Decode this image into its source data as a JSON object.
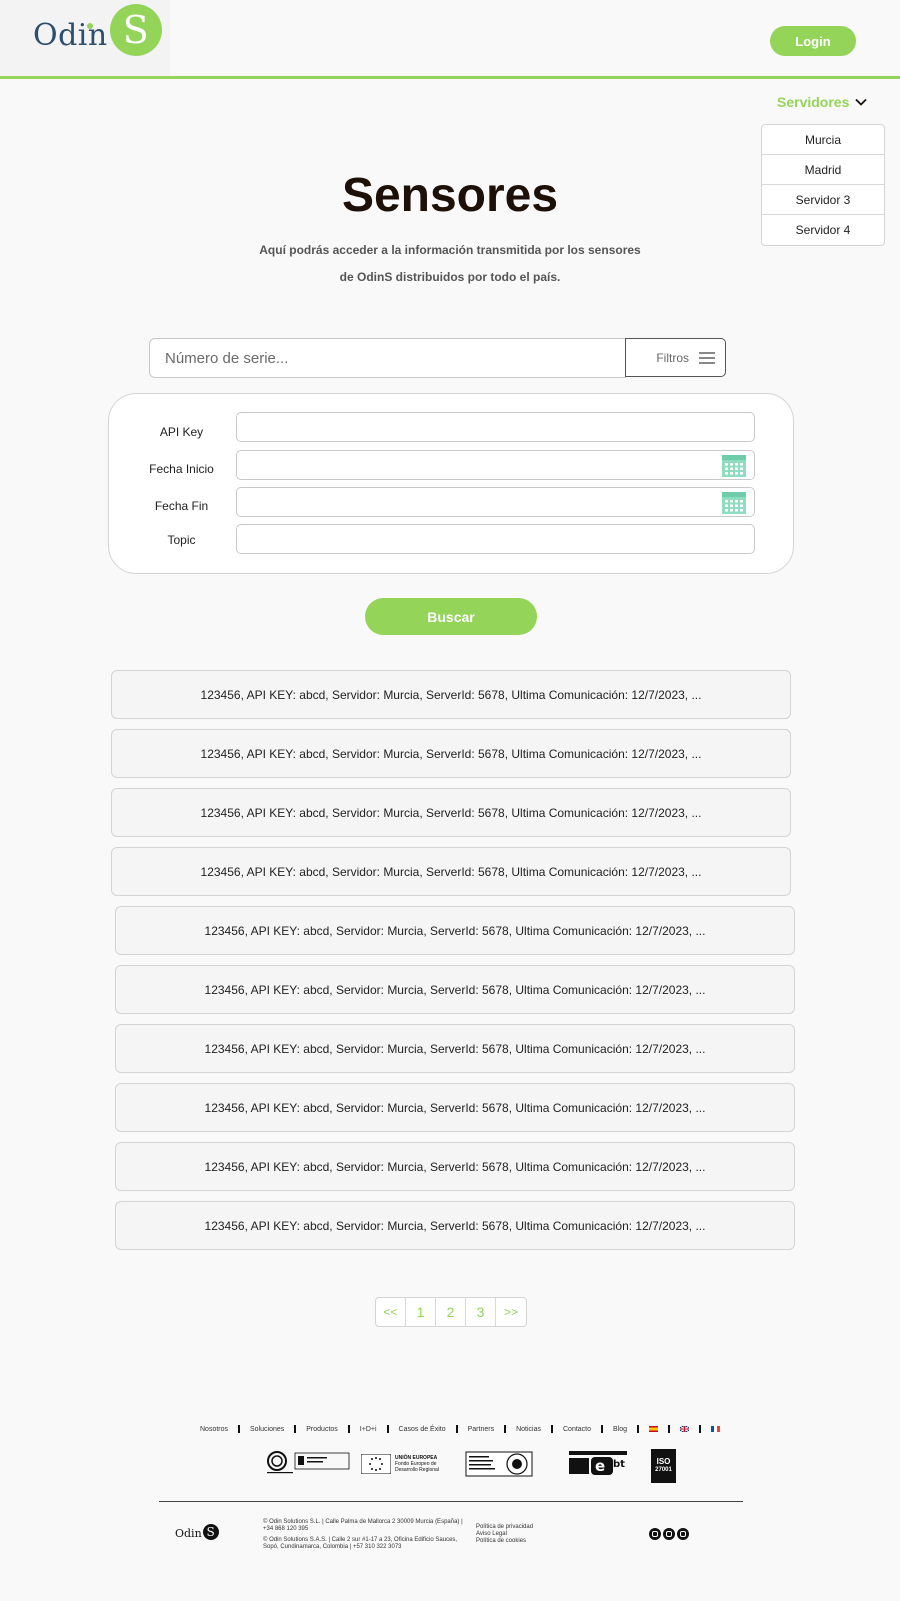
{
  "header": {
    "logo_text": "Odin",
    "logo_letter": "S",
    "login_label": "Login"
  },
  "servers": {
    "toggle_label": "Servidores",
    "items": [
      "Murcia",
      "Madrid",
      "Servidor 3",
      "Servidor 4"
    ]
  },
  "main": {
    "title": "Sensores",
    "subtitle_line1": "Aquí podrás acceder a la información transmitida por los sensores",
    "subtitle_line2": "de OdinS distribuidos por todo el país."
  },
  "search": {
    "placeholder": "Número de serie...",
    "value": "",
    "filter_label": "Filtros"
  },
  "filters": {
    "api_key_label": "API Key",
    "api_key_value": "",
    "fecha_inicio_label": "Fecha Inicio",
    "fecha_inicio_value": "",
    "fecha_fin_label": "Fecha Fin",
    "fecha_fin_value": "",
    "topic_label": "Topic",
    "topic_value": ""
  },
  "buscar_label": "Buscar",
  "results": [
    "123456, API KEY: abcd, Servidor: Murcia, ServerId: 5678, Ultima Comunicación: 12/7/2023, ...",
    "123456, API KEY: abcd, Servidor: Murcia, ServerId: 5678, Ultima Comunicación: 12/7/2023, ...",
    "123456, API KEY: abcd, Servidor: Murcia, ServerId: 5678, Ultima Comunicación: 12/7/2023, ...",
    "123456, API KEY: abcd, Servidor: Murcia, ServerId: 5678, Ultima Comunicación: 12/7/2023, ...",
    "123456, API KEY: abcd, Servidor: Murcia, ServerId: 5678, Ultima Comunicación: 12/7/2023, ...",
    "123456, API KEY: abcd, Servidor: Murcia, ServerId: 5678, Ultima Comunicación: 12/7/2023, ...",
    "123456, API KEY: abcd, Servidor: Murcia, ServerId: 5678, Ultima Comunicación: 12/7/2023, ...",
    "123456, API KEY: abcd, Servidor: Murcia, ServerId: 5678, Ultima Comunicación: 12/7/2023, ...",
    "123456, API KEY: abcd, Servidor: Murcia, ServerId: 5678, Ultima Comunicación: 12/7/2023, ...",
    "123456, API KEY: abcd, Servidor: Murcia, ServerId: 5678, Ultima Comunicación: 12/7/2023, ..."
  ],
  "pagination": {
    "prev": "<<",
    "pages": [
      "1",
      "2",
      "3"
    ],
    "next": ">>"
  },
  "footer": {
    "nav": [
      "Nosotros",
      "Soluciones",
      "Productos",
      "I+D+i",
      "Casos de Éxito",
      "Partners",
      "Noticias",
      "Contacto",
      "Blog"
    ],
    "eu_title": "UNIÓN EUROPEA",
    "eu_sub1": "Fondo Europeo de",
    "eu_sub2": "Desarrollo Regional",
    "iso_label": "ISO",
    "iso_number": "27001",
    "brand_text": "Odin",
    "brand_letter": "S",
    "address_es": "© Odin Solutions S.L. | Calle Palma de Mallorca 2 30009 Murcia (España) | +34 868 120 395",
    "address_co": "© Odin Solutions S.A.S. | Calle 2 sur #1-17 a 23, Oficina Edificio Sauces, Sopó, Cundinamarca, Colombia | +57 310 322 3073",
    "legal": [
      "Política de privacidad",
      "Aviso Legal",
      "Política de cookies"
    ]
  },
  "colors": {
    "accent": "#93d459",
    "title": "#1d1006",
    "logo_text": "#2e4e6e",
    "calendar": "#8fdcc1"
  },
  "icons": [
    "chevron-down-icon",
    "menu-icon",
    "calendar-icon",
    "instagram-icon",
    "linkedin-icon",
    "youtube-icon"
  ]
}
